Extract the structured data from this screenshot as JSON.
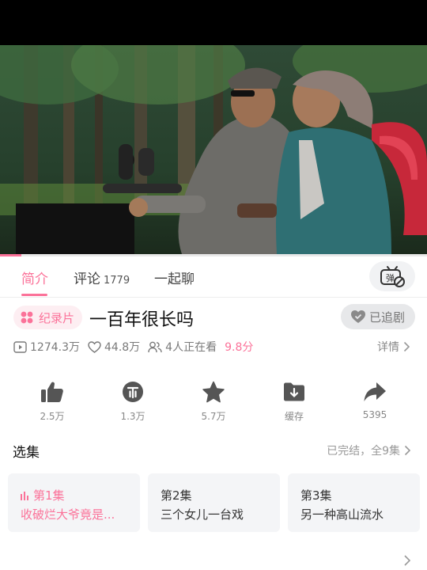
{
  "tabs": [
    {
      "label": "简介",
      "active": true
    },
    {
      "label": "评论",
      "count": "1779"
    },
    {
      "label": "一起聊"
    }
  ],
  "danmaku_button": {
    "icon": "danmaku-toggle-icon",
    "label": "弹"
  },
  "title_row": {
    "badge_label": "纪录片",
    "title": "一百年很长吗",
    "follow_label": "已追剧"
  },
  "stats": {
    "plays": "1274.3万",
    "likes": "44.8万",
    "watching": "4人正在看",
    "score": "9.8分",
    "detail_label": "详情"
  },
  "actions": [
    {
      "icon": "thumbs-up-icon",
      "label": "2.5万"
    },
    {
      "icon": "coin-icon",
      "label": "1.3万"
    },
    {
      "icon": "star-icon",
      "label": "5.7万"
    },
    {
      "icon": "download-folder-icon",
      "label": "缓存"
    },
    {
      "icon": "share-icon",
      "label": "5395"
    }
  ],
  "episodes": {
    "heading": "选集",
    "status": "已完结，全9集",
    "items": [
      {
        "number": "第1集",
        "title": "收破烂大爷竟是...",
        "active": true
      },
      {
        "number": "第2集",
        "title": "三个女儿一台戏"
      },
      {
        "number": "第3集",
        "title": "另一种高山流水"
      }
    ]
  },
  "playback": {
    "progress_fraction": 0.05
  },
  "colors": {
    "accent": "#fb7299",
    "muted": "#888888"
  }
}
